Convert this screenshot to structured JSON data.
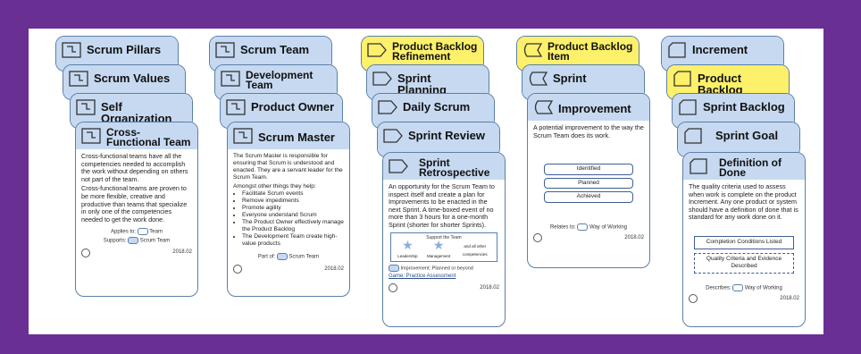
{
  "col1": {
    "stack": [
      "Scrum Pillars",
      "Scrum Values",
      "Self Organization"
    ],
    "front": {
      "title": "Cross-Functional Team",
      "para1": "Cross-functional teams have all the competencies needed to accomplish the work without depending on others not part of the team.",
      "para2": "Cross-functional teams are proven to be more flexible, creative and productive than teams that specialize in only one of the competencies needed to get the work done.",
      "applies": "Applies to:",
      "applies_val": "Team",
      "supports": "Supports:",
      "supports_val": "Scrum Team",
      "version": "2018.02"
    }
  },
  "col2": {
    "stack": [
      "Scrum Team",
      "Development Team",
      "Product Owner"
    ],
    "front": {
      "title": "Scrum Master",
      "para1": "The Scrum Master is responsible for ensuring that Scrum is understood and enacted. They are a servant leader for the Scrum Team.",
      "para2": "Amongst other things they help:",
      "bullets": [
        "Facilitate Scrum events",
        "Remove impediments",
        "Promote agility",
        "Everyone understand Scrum",
        "The Product Owner effectively manage the Product Backlog",
        "The Development Team create high-value products"
      ],
      "partof": "Part of:",
      "partof_val": "Scrum Team",
      "version": "2018.02"
    }
  },
  "col3": {
    "stack": [
      "Product Backlog Refinement",
      "Sprint Planning",
      "Daily Scrum",
      "Sprint Review"
    ],
    "front": {
      "title": "Sprint Retrospective",
      "para1": "An opportunity for the Scrum Team to inspect itself and create a plan for Improvements to be enacted in the next Sprint. A time-boxed event of no more than 3 hours for a one-month Sprint (shorter for shorter Sprints).",
      "support": "Support the Team",
      "leader": "Leadership",
      "mgmt": "Management",
      "others": "and all other competencies",
      "improve": "Improvement: Planned or beyond",
      "game": "Game: Practice Assessment",
      "version": "2018.02"
    }
  },
  "col4": {
    "stack": [
      "Product Backlog Item",
      "Sprint"
    ],
    "front": {
      "title": "Improvement",
      "para1": "A potential improvement to the way the Scrum Team does its work.",
      "states": [
        "Identified",
        "Planned",
        "Achieved"
      ],
      "relates": "Relates to:",
      "relates_val": "Way of Working",
      "version": "2018.02"
    }
  },
  "col5": {
    "stack": [
      "Increment",
      "Product Backlog",
      "Sprint Backlog",
      "Sprint Goal"
    ],
    "front": {
      "title": "Definition of Done",
      "para1": "The quality criteria used to assess when work is complete on the product Increment. Any one product or system should have a definition of done that is standard for any work done on it.",
      "cond1": "Completion Conditions Listed",
      "cond2": "Quality Criteria and Evidence Described",
      "describes": "Describes:",
      "describes_val": "Way of Working",
      "version": "2018.02"
    }
  }
}
